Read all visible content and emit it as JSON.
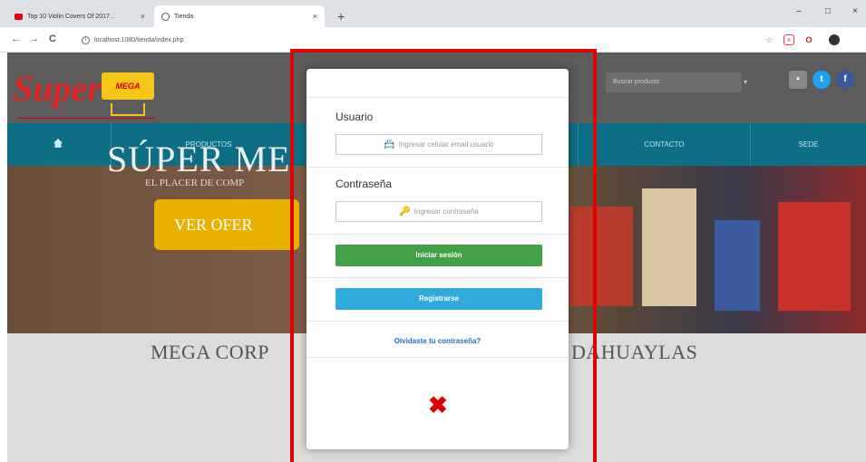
{
  "browser": {
    "tabs": [
      {
        "title": "Top 10 Violin Covers Of 2017...",
        "active": false
      },
      {
        "title": "Tienda",
        "active": true
      }
    ],
    "url": "localhost:1080/tienda/index.php",
    "nav": {
      "back": "←",
      "forward": "→",
      "reload": "C"
    },
    "window": {
      "minimize": "–",
      "maximize": "□",
      "close": "×"
    },
    "extensions": [
      "star-icon",
      "extension-icon",
      "opera-icon",
      "profile-icon"
    ]
  },
  "site": {
    "logo": {
      "word": "Super",
      "badge": "MEGA"
    },
    "search_placeholder": "Buscar producto",
    "nav_items": [
      "PRODUCTOS",
      "",
      "",
      "CONTACTO",
      "SEDE"
    ],
    "banner_title": "SÚPER ME",
    "banner_subtitle": "EL PLACER DE COMP",
    "banner_button": "VER OFER",
    "corporate_left": "MEGA CORP",
    "corporate_right": "DAHUAYLAS"
  },
  "modal": {
    "user_label": "Usuario",
    "user_placeholder": "Ingresar celular email usuario",
    "password_label": "Contraseña",
    "password_placeholder": "Ingresar contraseña",
    "login_button": "Iniciar sesión",
    "register_button": "Registrarse",
    "forgot_link": "Olvidaste tu contraseña?",
    "close_glyph": "✖"
  },
  "colors": {
    "highlight": "#e00000",
    "login": "#43a047",
    "register": "#31aadc",
    "navbar": "#0d6f86"
  }
}
